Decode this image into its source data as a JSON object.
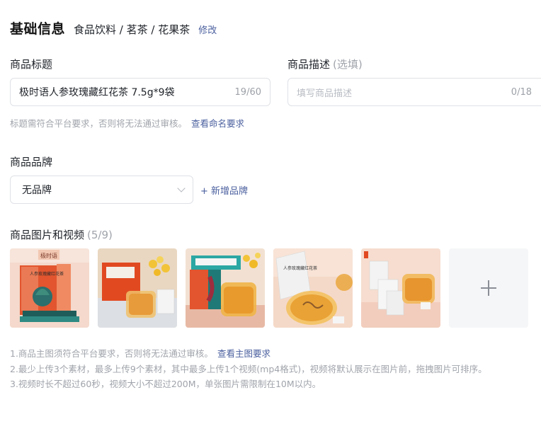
{
  "header": {
    "title": "基础信息",
    "category": "食品饮料 / 茗茶 / 花果茶",
    "edit_label": "修改"
  },
  "title_field": {
    "label": "商品标题",
    "value": "极时语人参玫瑰藏红花茶 7.5g*9袋",
    "count": "19/60",
    "hint": "标题需符合平台要求，否则将无法通过审核。",
    "hint_link": "查看命名要求"
  },
  "desc_field": {
    "label": "商品描述",
    "optional": "(选填)",
    "placeholder": "填写商品描述",
    "count": "0/18"
  },
  "brand": {
    "label": "商品品牌",
    "value": "无品牌",
    "add_label": "+ 新增品牌"
  },
  "media": {
    "label": "商品图片和视频",
    "count": "(5/9)",
    "images": [
      {
        "alt": "product-box-front",
        "package_text": "人参玫瑰藏红花茶",
        "brand_text": "极时语"
      },
      {
        "alt": "product-box-and-cup"
      },
      {
        "alt": "gift-box-and-cup"
      },
      {
        "alt": "tea-pouch-and-cup",
        "package_text": "人参玫瑰藏红花茶"
      },
      {
        "alt": "pouches-and-cup"
      }
    ]
  },
  "notes": {
    "line1": "1.商品主图须符合平台要求，否则将无法通过审核。",
    "line1_link": "查看主图要求",
    "line2": "2.最少上传3个素材，最多上传9个素材，其中最多上传1个视频(mp4格式)，视频将默认展示在图片前，拖拽图片可排序。",
    "line3": "3.视频时长不超过60秒，视频大小不超过200M，单张图片需限制在10M以内。"
  },
  "colors": {
    "link": "#4a5f9e",
    "muted": "#a0a4ab",
    "border": "#dfe1e6"
  }
}
